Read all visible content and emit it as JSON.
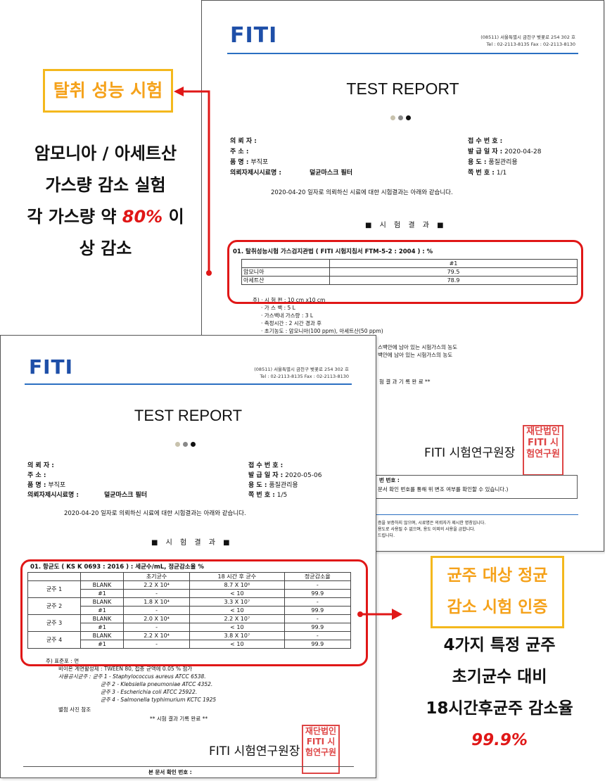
{
  "back_report": {
    "logo": "FITI",
    "address_line1": "(08511) 서울특별시 금천구 벚꽃로 254 302 호",
    "address_line2": "Tel : 02-2113-8135   Fax : 02-2113-8130",
    "title": "TEST REPORT",
    "fields_left": [
      {
        "label": "의 뢰 자 :",
        "value": ""
      },
      {
        "label": "주      소 :",
        "value": ""
      },
      {
        "label": "품      명 :",
        "value": "부직포"
      },
      {
        "label": "의뢰자제시시료명 :",
        "value": "덜균마스크 필터"
      }
    ],
    "fields_right": [
      {
        "label": "접 수 번 호 :",
        "value": ""
      },
      {
        "label": "발 급 일 자 :",
        "value": "2020-04-28"
      },
      {
        "label": "용      도 :",
        "value": "품질관리용"
      },
      {
        "label": "쪽   번  호 :",
        "value": "1/1"
      }
    ],
    "intro": "2020-04-20 일자로 의뢰하신 시료에 대한 시험결과는 아래와 같습니다.",
    "section": "■  시 험 결 과  ■",
    "test_title": "01.  탈취성능시험 가스검지관법 ( FITI 시험지침서 FTM-5-2 : 2004 ) : %",
    "table_header": [
      "",
      "#1"
    ],
    "table_rows": [
      [
        "암모니아",
        "79.5"
      ],
      [
        "아세트산",
        "78.9"
      ]
    ],
    "notes": [
      "주) ·  시  험  편 : 10 cm  x10 cm",
      "·  가  스  백 : 5 L",
      "·  가스백내 가스량 : 3 L",
      "·  측정시간 : 2 시간 경과 후",
      "·  초기농도 : 암모니아(100 ppm), 아세트산(50 ppm)"
    ],
    "note_tail1": "스백안에 남아 있는 시험가스의 농도",
    "note_tail2": "백안에 남아 있는 시험가스의 농도",
    "end_text": "험 결 과  기 록  완 료 **",
    "institute": "FITI 시험연구원장",
    "verify_label": "번 번호 :",
    "verify_text": "문서 확인 번호를 통해 위 변조 여부를 확인할 수 있습니다.)",
    "footer1": "증을 보증하지 않으며, 시료명은 의뢰자가 제시한 명칭입니다.",
    "footer2": "용도로 사용될 수 없으며, 용도 이외의 사용을 금합니다.",
    "footer3": "드립니다."
  },
  "front_report": {
    "logo": "FITI",
    "address_line1": "(08511) 서울특별시 금천구 벚꽃로 254 302 호",
    "address_line2": "Tel : 02-2113-8135   Fax : 02-2113-8130",
    "title": "TEST REPORT",
    "fields_left": [
      {
        "label": "의 뢰 자 :",
        "value": ""
      },
      {
        "label": "주      소 :",
        "value": ""
      },
      {
        "label": "품      명 :",
        "value": "부직포"
      },
      {
        "label": "의뢰자제시시료명 :",
        "value": "덜균마스크 필터"
      }
    ],
    "fields_right": [
      {
        "label": "접 수 번 호 :",
        "value": ""
      },
      {
        "label": "발 급 일 자 :",
        "value": "2020-05-06"
      },
      {
        "label": "용      도 :",
        "value": "품질관리용"
      },
      {
        "label": "쪽   번  호 :",
        "value": "1/5"
      }
    ],
    "intro": "2020-04-20 일자로 의뢰하신 시료에 대한 시험결과는 아래와 같습니다.",
    "section": "■  시 험 결 과  ■",
    "test_title": "01.  항균도 ( KS K 0693 : 2016 ) : 세균수/mL, 정균감소율 %",
    "table_header": [
      "",
      "",
      "초기균수",
      "18 시간 후 균수",
      "정균감소율"
    ],
    "table_groups": [
      {
        "name": "균주 1",
        "rows": [
          [
            "BLANK",
            "2.2 X 10⁴",
            "8.7 X 10⁶",
            "-"
          ],
          [
            "#1",
            "-",
            "< 10",
            "99.9"
          ]
        ]
      },
      {
        "name": "균주 2",
        "rows": [
          [
            "BLANK",
            "1.8 X 10⁴",
            "3.3 X 10⁷",
            "-"
          ],
          [
            "#1",
            "-",
            "< 10",
            "99.9"
          ]
        ]
      },
      {
        "name": "균주 3",
        "rows": [
          [
            "BLANK",
            "2.0 X 10⁴",
            "2.2 X 10⁷",
            "-"
          ],
          [
            "#1",
            "-",
            "< 10",
            "99.9"
          ]
        ]
      },
      {
        "name": "균주 4",
        "rows": [
          [
            "BLANK",
            "2.2 X 10⁴",
            "3.8 X 10⁷",
            "-"
          ],
          [
            "#1",
            "-",
            "< 10",
            "99.9"
          ]
        ]
      }
    ],
    "notes": [
      "주) 표준포         : 면",
      "비이온 계면활성제 : TWEEN 80, 접종 균액에 0.05 % 첨가",
      "사용공시균주 : 균주 1 - Staphylococcus aureus ATCC 6538.",
      "균주 2 - Klebsiella pneumoniae ATCC 4352.",
      "균주 3 - Escherichia coli ATCC 25922.",
      "균주 4 - Salmonella typhimurium KCTC 1925",
      "별첨 사진 참조"
    ],
    "end_text": "** 시험 결과 기록 완료 **",
    "institute": "FITI 시험연구원장",
    "verify_label": "본 문서 확인 번호 :"
  },
  "callouts": {
    "deodor_label": "탈취 성능 시험",
    "deodor_desc1": "암모니아 / 아세트산",
    "deodor_desc2": "가스량 감소 실험",
    "deodor_desc3_pre": "각 가스량 약 ",
    "deodor_desc3_red": "80%",
    "deodor_desc3_post": " 이",
    "deodor_desc4": "상 감소",
    "antibac_label1": "균주 대상 정균",
    "antibac_label2": "감소 시험 인증",
    "antibac_desc1": "4가지 특정 균주",
    "antibac_desc2": "초기균수 대비",
    "antibac_desc3": "18시간후균주 감소율",
    "antibac_desc4": "99.9%"
  },
  "stamp_text": "재단법인 FITI 시험연구원",
  "colors": {
    "accent_red": "#e01717",
    "accent_orange": "#f5a21b",
    "logo_blue": "#1e4fa8"
  }
}
